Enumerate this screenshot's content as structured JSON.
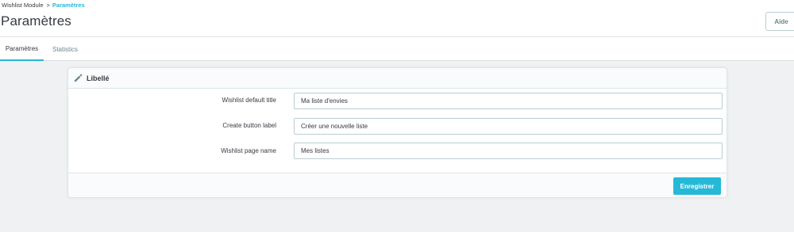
{
  "breadcrumb": {
    "parent": "Wishlist Module",
    "separator": ">",
    "current": "Paramètres"
  },
  "header": {
    "title": "Paramètres",
    "help_label": "Aide"
  },
  "tabs": [
    {
      "label": "Paramètres",
      "active": true
    },
    {
      "label": "Statistics",
      "active": false
    }
  ],
  "panel": {
    "icon": "pencil-icon",
    "title": "Libellé",
    "fields": [
      {
        "label": "Wishlist default title",
        "value": "Ma liste d'envies"
      },
      {
        "label": "Create button label",
        "value": "Créer une nouvelle liste"
      },
      {
        "label": "Wishlist page name",
        "value": "Mes listes"
      }
    ],
    "save_label": "Enregistrer"
  },
  "colors": {
    "accent": "#25b9d7",
    "background": "#eff1f2",
    "text": "#363a41"
  }
}
